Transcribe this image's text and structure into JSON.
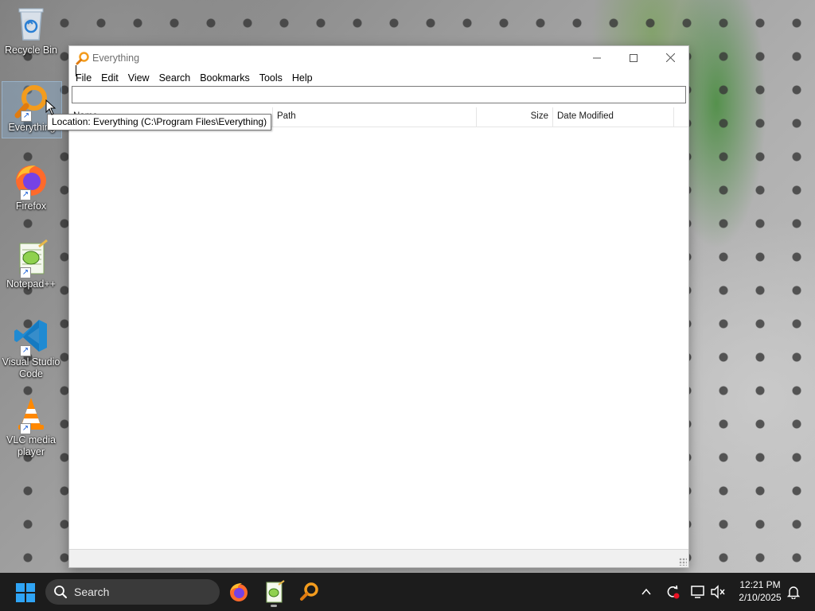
{
  "desktop": {
    "icons": [
      {
        "label": "Recycle Bin",
        "icon": "recycle-bin-icon"
      },
      {
        "label": "Everything",
        "icon": "everything-magnifier-icon"
      },
      {
        "label": "Firefox",
        "icon": "firefox-icon"
      },
      {
        "label": "Notepad++",
        "icon": "notepad-plus-plus-icon"
      },
      {
        "label": "Visual Studio Code",
        "icon": "vscode-icon"
      },
      {
        "label": "VLC media player",
        "icon": "vlc-cone-icon"
      }
    ]
  },
  "tooltip": {
    "text": "Location: Everything (C:\\Program Files\\Everything)"
  },
  "window": {
    "title": "Everything",
    "menu": [
      "File",
      "Edit",
      "View",
      "Search",
      "Bookmarks",
      "Tools",
      "Help"
    ],
    "search": {
      "value": "",
      "placeholder": ""
    },
    "columns": {
      "name": "Name",
      "path": "Path",
      "size": "Size",
      "date_modified": "Date Modified"
    },
    "results": [],
    "status_text": ""
  },
  "taskbar": {
    "search_label": "Search",
    "pinned_apps": [
      "Firefox",
      "Notepad++",
      "Everything"
    ],
    "clock": {
      "time": "12:21 PM",
      "date": "2/10/2025"
    }
  },
  "colors": {
    "taskbar_bg": "#1c1c1c",
    "everything_orange": "#f39c1e",
    "start_blue": "#2fa4f5"
  }
}
